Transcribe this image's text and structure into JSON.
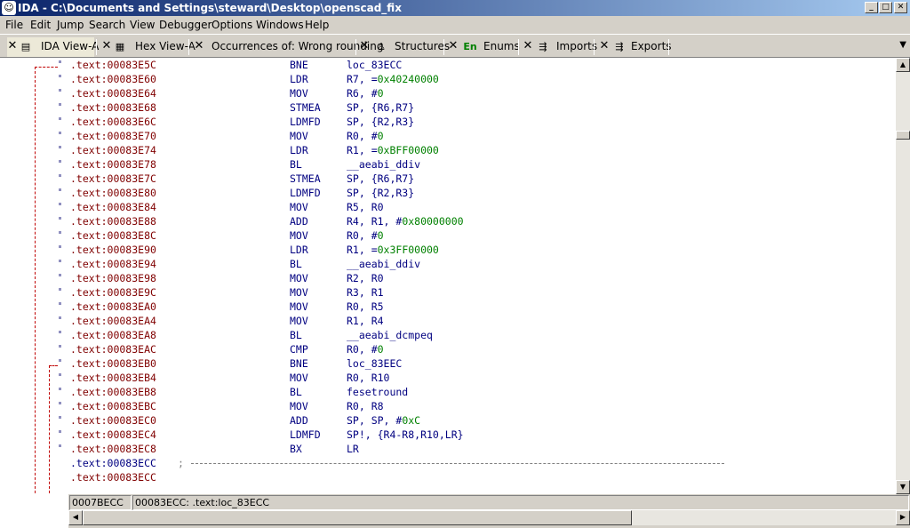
{
  "window": {
    "title": "IDA - C:\\Documents and Settings\\steward\\Desktop\\openscad_fix",
    "app_icon": "ida-icon",
    "controls": [
      "minimize",
      "maximize",
      "close"
    ]
  },
  "menu": [
    "File",
    "Edit",
    "Jump",
    "Search",
    "View",
    "Debugger",
    "Options",
    "Windows",
    "Help"
  ],
  "tabs": [
    {
      "label": "IDA View-A",
      "icon": "text-view-icon",
      "active": true
    },
    {
      "label": "Hex View-A",
      "icon": "hex-view-icon",
      "active": false
    },
    {
      "label": "Occurrences of: Wrong rounding",
      "icon": "",
      "active": false
    },
    {
      "label": "Structures",
      "icon": "struct-icon",
      "active": false
    },
    {
      "label": "Enums",
      "icon": "enum-icon",
      "icon_text": "En",
      "active": false
    },
    {
      "label": "Imports",
      "icon": "imports-icon",
      "active": false
    },
    {
      "label": "Exports",
      "icon": "exports-icon",
      "active": false
    }
  ],
  "code_lines": [
    {
      "addr": ".text:00083E5C",
      "mnem": "BNE",
      "ops": "loc_83ECC"
    },
    {
      "addr": ".text:00083E60",
      "mnem": "LDR",
      "ops": "R7, =",
      "num": "0x40240000"
    },
    {
      "addr": ".text:00083E64",
      "mnem": "MOV",
      "ops": "R6, #",
      "num": "0"
    },
    {
      "addr": ".text:00083E68",
      "mnem": "STMEA",
      "ops": "SP, {R6,R7}"
    },
    {
      "addr": ".text:00083E6C",
      "mnem": "LDMFD",
      "ops": "SP, {R2,R3}"
    },
    {
      "addr": ".text:00083E70",
      "mnem": "MOV",
      "ops": "R0, #",
      "num": "0"
    },
    {
      "addr": ".text:00083E74",
      "mnem": "LDR",
      "ops": "R1, =",
      "num": "0xBFF00000"
    },
    {
      "addr": ".text:00083E78",
      "mnem": "BL",
      "ops": "__aeabi_ddiv"
    },
    {
      "addr": ".text:00083E7C",
      "mnem": "STMEA",
      "ops": "SP, {R6,R7}"
    },
    {
      "addr": ".text:00083E80",
      "mnem": "LDMFD",
      "ops": "SP, {R2,R3}"
    },
    {
      "addr": ".text:00083E84",
      "mnem": "MOV",
      "ops": "R5, R0"
    },
    {
      "addr": ".text:00083E88",
      "mnem": "ADD",
      "ops": "R4, R1, #",
      "num": "0x80000000"
    },
    {
      "addr": ".text:00083E8C",
      "mnem": "MOV",
      "ops": "R0, #",
      "num": "0"
    },
    {
      "addr": ".text:00083E90",
      "mnem": "LDR",
      "ops": "R1, =",
      "num": "0x3FF00000"
    },
    {
      "addr": ".text:00083E94",
      "mnem": "BL",
      "ops": "__aeabi_ddiv"
    },
    {
      "addr": ".text:00083E98",
      "mnem": "MOV",
      "ops": "R2, R0"
    },
    {
      "addr": ".text:00083E9C",
      "mnem": "MOV",
      "ops": "R3, R1"
    },
    {
      "addr": ".text:00083EA0",
      "mnem": "MOV",
      "ops": "R0, R5"
    },
    {
      "addr": ".text:00083EA4",
      "mnem": "MOV",
      "ops": "R1, R4"
    },
    {
      "addr": ".text:00083EA8",
      "mnem": "BL",
      "ops": "__aeabi_dcmpeq"
    },
    {
      "addr": ".text:00083EAC",
      "mnem": "CMP",
      "ops": "R0, #",
      "num": "0"
    },
    {
      "addr": ".text:00083EB0",
      "mnem": "BNE",
      "ops": "loc_83EEC"
    },
    {
      "addr": ".text:00083EB4",
      "mnem": "MOV",
      "ops": "R0, R10"
    },
    {
      "addr": ".text:00083EB8",
      "mnem": "BL",
      "ops": "fesetround"
    },
    {
      "addr": ".text:00083EBC",
      "mnem": "MOV",
      "ops": "R0, R8"
    },
    {
      "addr": ".text:00083EC0",
      "mnem": "ADD",
      "ops": "SP, SP, #",
      "num": "0xC"
    },
    {
      "addr": ".text:00083EC4",
      "mnem": "LDMFD",
      "ops": "SP!, {R4-R8,R10,LR}"
    },
    {
      "addr": ".text:00083EC8",
      "mnem": "BX",
      "ops": "LR"
    }
  ],
  "separator_line": {
    "addr": ".text:00083ECC",
    "comment": ";"
  },
  "last_line": {
    "addr": ".text:00083ECC"
  },
  "status": {
    "offset": "0007BECC",
    "location": "00083ECC: .text:loc_83ECC"
  },
  "colors": {
    "address": "#800000",
    "instruction": "#000080",
    "number": "#008000",
    "branch_arrow": "#c00000"
  }
}
